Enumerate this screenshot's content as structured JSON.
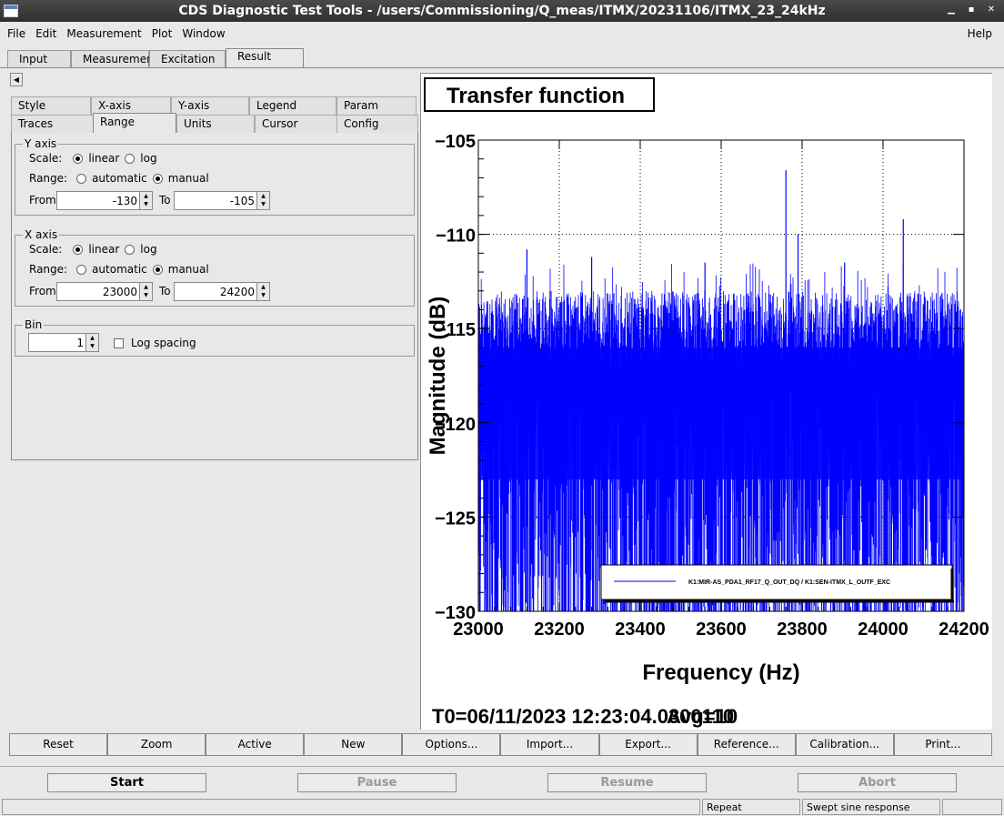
{
  "window": {
    "title": "CDS Diagnostic Test Tools - /users/Commissioning/Q_meas/ITMX/20231106/ITMX_23_24kHz"
  },
  "menu": {
    "items": [
      "File",
      "Edit",
      "Measurement",
      "Plot",
      "Window"
    ],
    "help": "Help"
  },
  "main_tabs": [
    "Input",
    "Measurement",
    "Excitation",
    "Result"
  ],
  "active_main_tab": "Result",
  "sub_tabs": {
    "row1": [
      "Style",
      "X-axis",
      "Y-axis",
      "Legend",
      "Param"
    ],
    "row2": [
      "Traces",
      "Range",
      "Units",
      "Cursor",
      "Config"
    ],
    "active": "Range"
  },
  "y_axis": {
    "legend": "Y axis",
    "scale_label": "Scale:",
    "scale_options": [
      "linear",
      "log"
    ],
    "scale_selected": "linear",
    "range_label": "Range:",
    "range_options": [
      "automatic",
      "manual"
    ],
    "range_selected": "manual",
    "from_label": "From",
    "from_value": "-130",
    "to_label": "To",
    "to_value": "-105"
  },
  "x_axis": {
    "legend": "X axis",
    "scale_label": "Scale:",
    "scale_options": [
      "linear",
      "log"
    ],
    "scale_selected": "linear",
    "range_label": "Range:",
    "range_options": [
      "automatic",
      "manual"
    ],
    "range_selected": "manual",
    "from_label": "From",
    "from_value": "23000",
    "to_label": "To",
    "to_value": "24200"
  },
  "bin": {
    "legend": "Bin",
    "value": "1",
    "log_spacing_label": "Log spacing",
    "log_spacing_checked": false
  },
  "plot": {
    "title": "Transfer function",
    "time_label": "T0=06/11/2023 12:23:04.0300110",
    "avg_label": "Avg=10"
  },
  "chart_data": {
    "type": "line",
    "title": "Transfer function",
    "xlabel": "Frequency (Hz)",
    "ylabel": "Magnitude (dB)",
    "xlim": [
      23000,
      24200
    ],
    "ylim": [
      -130,
      -105
    ],
    "x_ticks": [
      23000,
      23200,
      23400,
      23600,
      23800,
      24000,
      24200
    ],
    "y_ticks": [
      -105,
      -110,
      -115,
      -120,
      -125,
      -130
    ],
    "grid": true,
    "legend_position": "bottom-right",
    "series": [
      {
        "name": "K1:MIR-AS_PDA1_RF17_Q_OUT_DQ / K1:SEN-ITMX_L_OUTF_EXC",
        "color": "#0000ff",
        "description_values": {
          "typical_band": [
            -130,
            -116
          ],
          "peaks": [
            [
              23120,
              -110.8
            ],
            [
              23280,
              -111.2
            ],
            [
              23560,
              -111.5
            ],
            [
              23760,
              -106.6
            ],
            [
              23790,
              -110.0
            ],
            [
              24050,
              -109.2
            ],
            [
              23905,
              -111.5
            ]
          ]
        }
      }
    ]
  },
  "buttons": [
    "Reset",
    "Zoom",
    "Active",
    "New",
    "Options...",
    "Import...",
    "Export...",
    "Reference...",
    "Calibration...",
    "Print..."
  ],
  "controls": {
    "start": "Start",
    "pause": "Pause",
    "resume": "Resume",
    "abort": "Abort"
  },
  "status": {
    "repeat": "Repeat",
    "mode": "Swept sine response"
  }
}
